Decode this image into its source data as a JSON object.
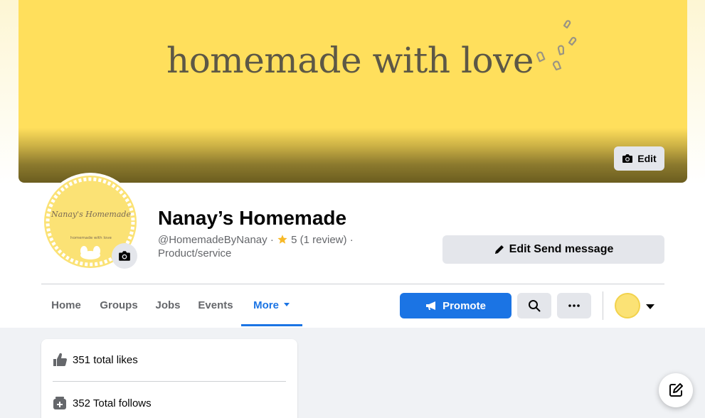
{
  "cover": {
    "text": "homemade with love",
    "edit_label": "Edit",
    "bg_color": "#ffdf5c"
  },
  "profile": {
    "logo_title": "Nanay's Homemade",
    "logo_tagline": "homemade with love",
    "name": "Nanay’s Homemade",
    "handle": "@HomemadeByNanay",
    "separator": "·",
    "rating_icon": "star-icon",
    "rating": "5 (1 review)",
    "category": "Product/service"
  },
  "actions": {
    "send_message_label": "Edit Send message",
    "promote_label": "Promote"
  },
  "tabs": [
    {
      "label": "Home"
    },
    {
      "label": "Groups"
    },
    {
      "label": "Jobs"
    },
    {
      "label": "Events"
    },
    {
      "label": "More"
    }
  ],
  "intro": {
    "likes": "351 total likes",
    "follows": "352 Total follows"
  },
  "colors": {
    "accent": "#1b74e4",
    "brand_yellow": "#ffdf5c"
  }
}
